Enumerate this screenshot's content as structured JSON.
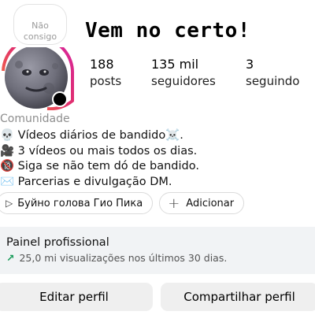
{
  "profile": {
    "username": "Vem no certo!",
    "note": [
      "Não",
      "consigo"
    ]
  },
  "stats": [
    {
      "value": "188",
      "label": "posts"
    },
    {
      "value": "135 mil",
      "label": "seguidores"
    },
    {
      "value": "3",
      "label": "seguindo"
    }
  ],
  "category": "Comunidade",
  "bio": [
    "💀 Vídeos diários de bandido☠️.",
    "🎥 3 vídeos ou mais todos os dias.",
    "🔞 Siga se não tem dó de bandido.",
    "✉️ Parcerias e divulgação DM."
  ],
  "chips": [
    {
      "label": "Буйно голова Гио Пика",
      "icon": "play-icon"
    },
    {
      "label": "Adicionar",
      "icon": "plus-icon"
    }
  ],
  "professional": {
    "title": "Painel profissional",
    "subtitle": "25,0 mi visualizações nos últimos 30 dias."
  },
  "buttons": {
    "edit": "Editar perfil",
    "share": "Compartilhar perfil"
  },
  "colors": {
    "accent_green": "#1a9c5b",
    "ring_pink": "#d6249f",
    "ring_orange": "#fd8b2c"
  }
}
